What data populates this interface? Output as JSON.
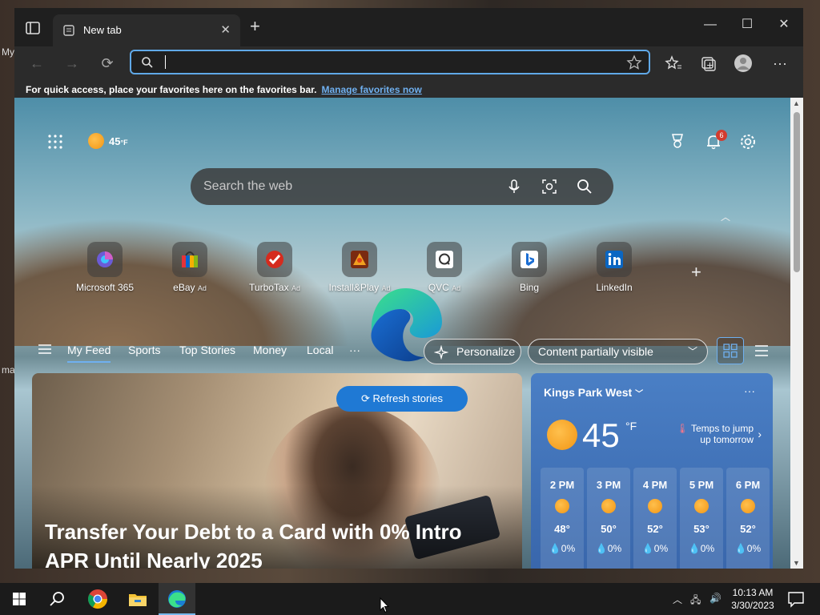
{
  "desktop": {
    "labels": [
      "My",
      "ma"
    ]
  },
  "browser": {
    "tab_title": "New tab",
    "window_controls": {
      "minimize": "—",
      "maximize": "☐",
      "close": "✕"
    },
    "favorites_bar": {
      "message": "For quick access, place your favorites here on the favorites bar.",
      "link": "Manage favorites now"
    }
  },
  "newtab": {
    "temperature_mini": "45",
    "temperature_unit": "°F",
    "notification_count": "6",
    "search_placeholder": "Search the web",
    "tiles": [
      {
        "label": "Microsoft 365",
        "ad": ""
      },
      {
        "label": "eBay",
        "ad": "Ad"
      },
      {
        "label": "TurboTax",
        "ad": "Ad"
      },
      {
        "label": "Install&Play",
        "ad": "Ad"
      },
      {
        "label": "QVC",
        "ad": "Ad"
      },
      {
        "label": "Bing",
        "ad": ""
      },
      {
        "label": "LinkedIn",
        "ad": ""
      }
    ],
    "nav_tabs": [
      "My Feed",
      "Sports",
      "Top Stories",
      "Money",
      "Local"
    ],
    "more_label": "···",
    "personalize_label": "Personalize",
    "content_visibility": "Content partially visible",
    "refresh_label": "Refresh stories",
    "hero_headline": "Transfer Your Debt to a Card with 0% Intro APR Until Nearly 2025"
  },
  "weather": {
    "location": "Kings Park West",
    "temp": "45",
    "unit": "°F",
    "alert": "Temps to jump up tomorrow",
    "hourly": [
      {
        "time": "2 PM",
        "temp": "48°",
        "precip": "0%"
      },
      {
        "time": "3 PM",
        "temp": "50°",
        "precip": "0%"
      },
      {
        "time": "4 PM",
        "temp": "52°",
        "precip": "0%"
      },
      {
        "time": "5 PM",
        "temp": "53°",
        "precip": "0%"
      },
      {
        "time": "6 PM",
        "temp": "52°",
        "precip": "0%"
      }
    ]
  },
  "taskbar": {
    "time": "10:13 AM",
    "date": "3/30/2023"
  },
  "colors": {
    "accent": "#60a9e8",
    "link": "#6fb0f0",
    "refresh_button": "#1f79d4",
    "weather_card": "#4a7fc5"
  }
}
